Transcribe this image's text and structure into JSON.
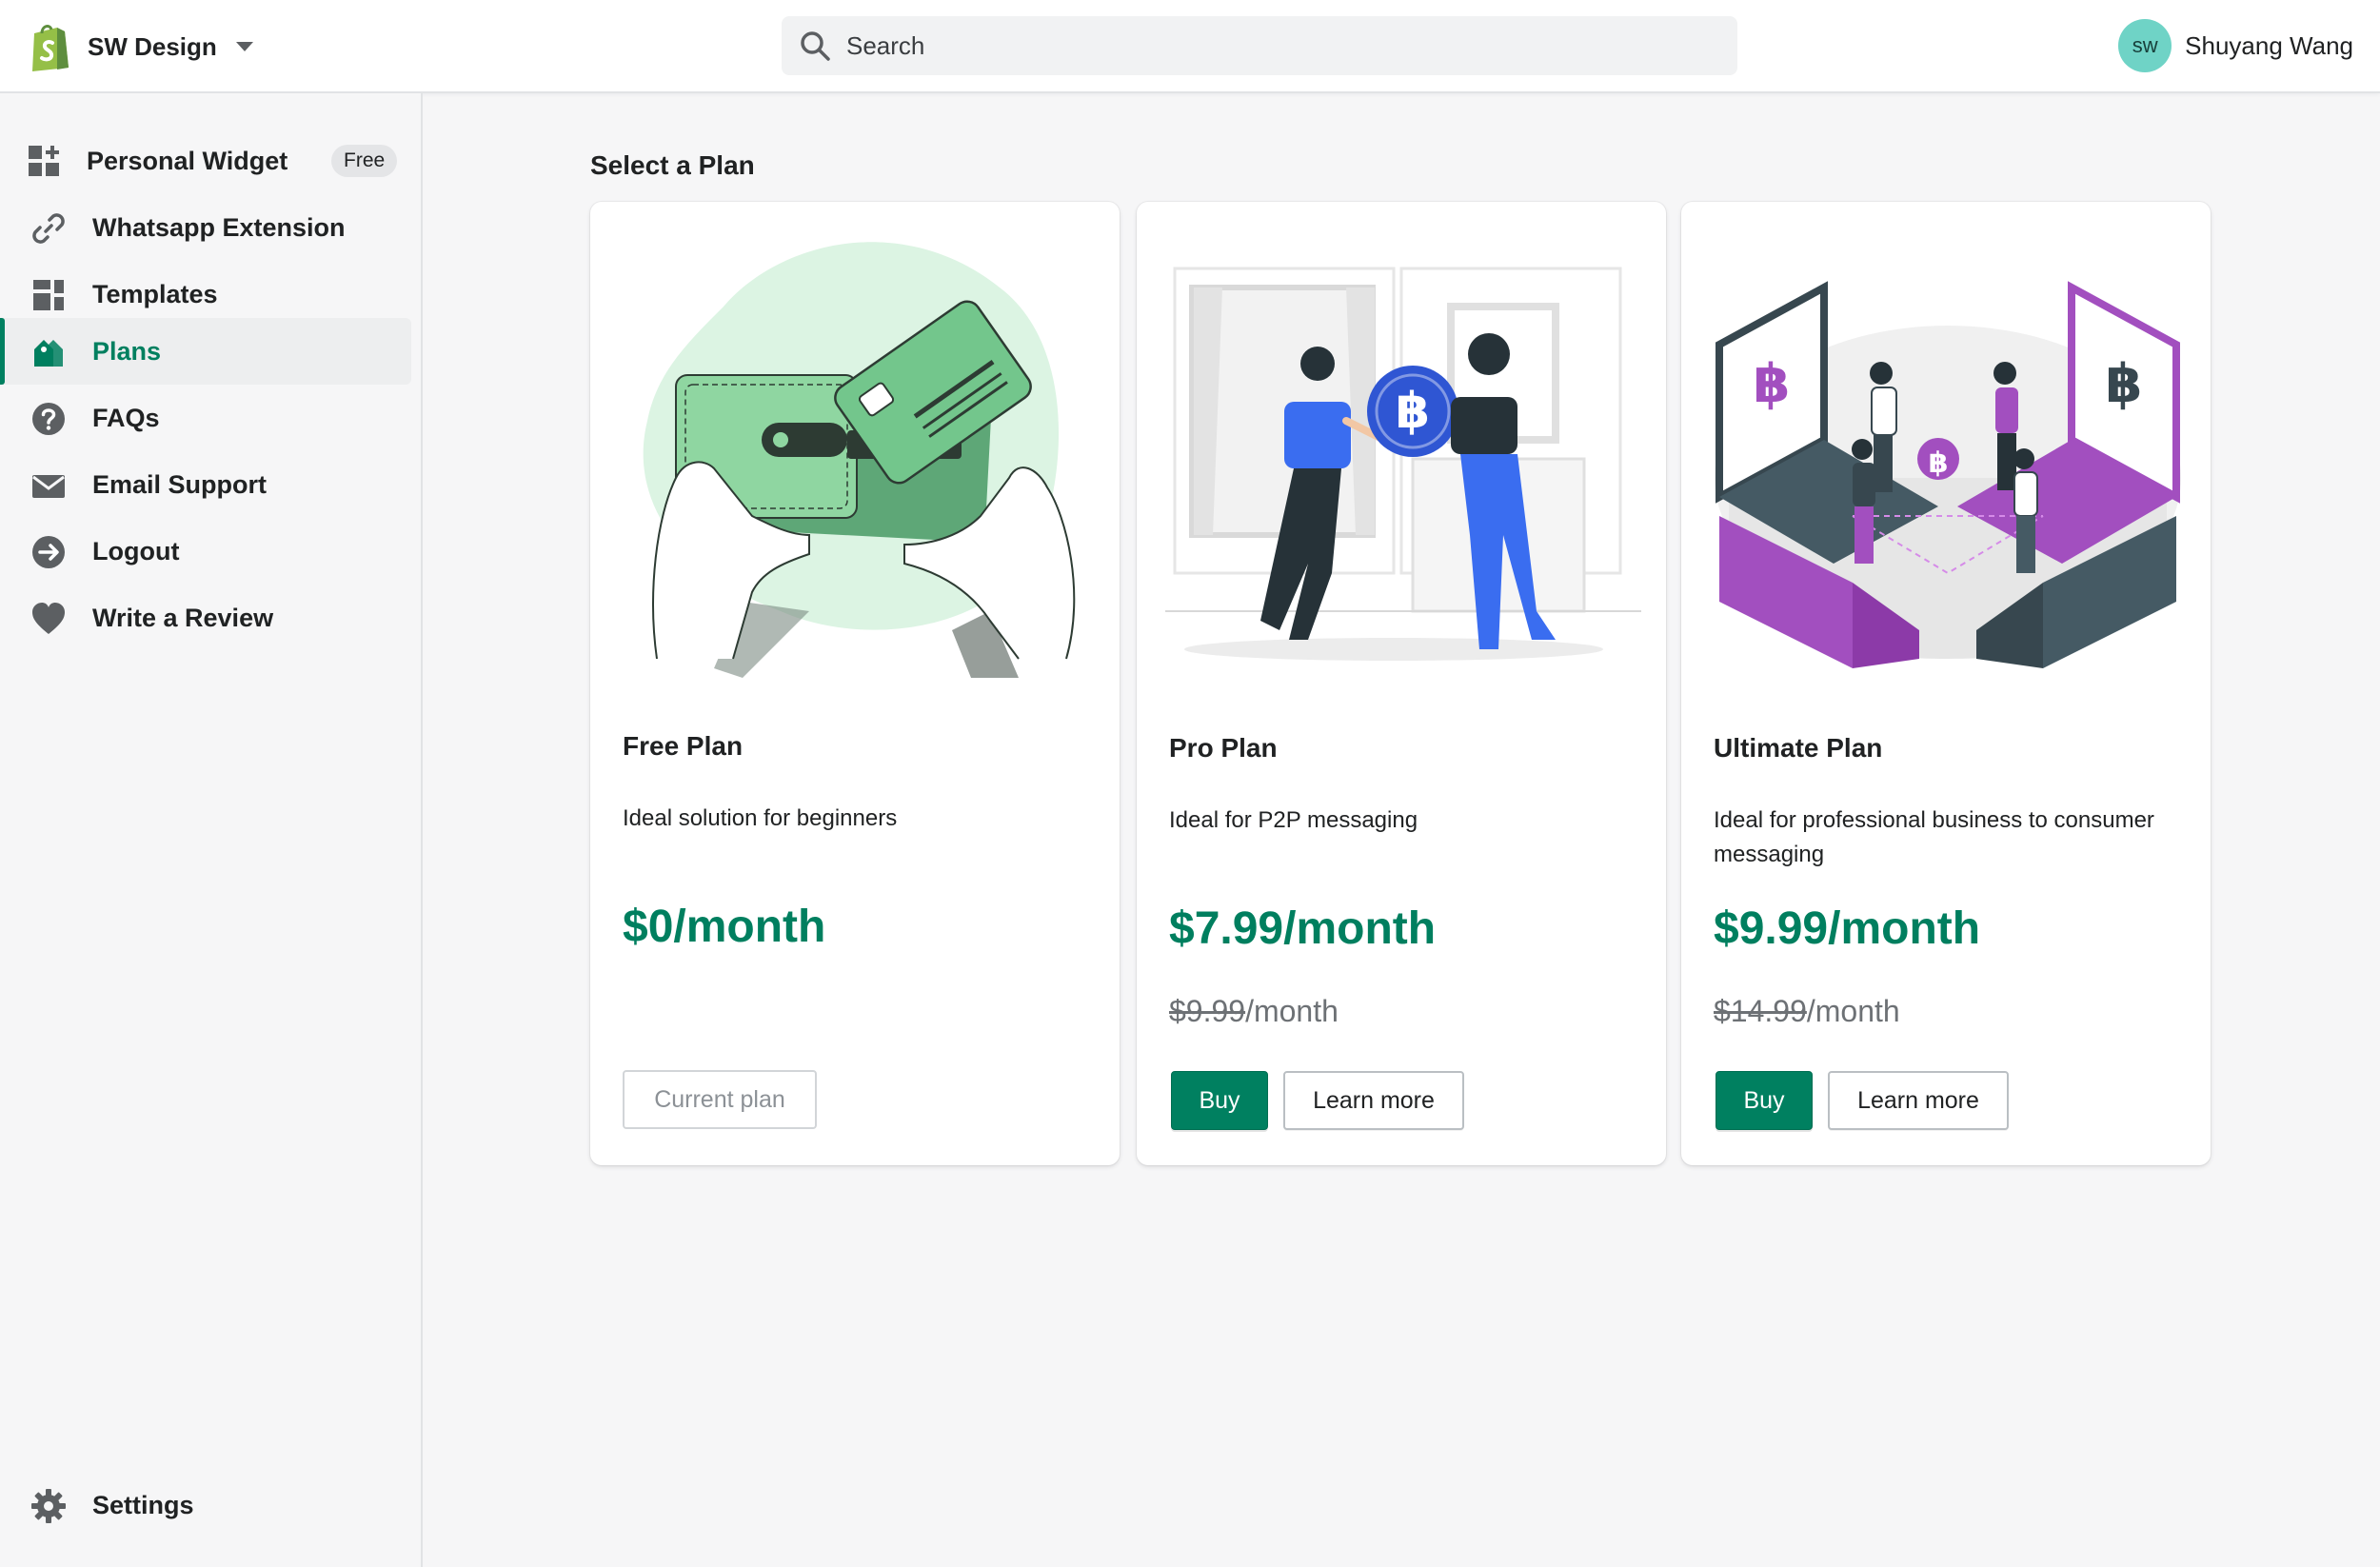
{
  "store": {
    "name": "SW Design"
  },
  "search": {
    "placeholder": "Search"
  },
  "user": {
    "initials": "sw",
    "name": "Shuyang Wang"
  },
  "sidebar": {
    "items": [
      {
        "label": "Personal Widget",
        "icon": "widget-icon",
        "badge": "Free"
      },
      {
        "label": "Whatsapp Extension",
        "icon": "link-icon"
      },
      {
        "label": "Templates",
        "icon": "templates-icon"
      },
      {
        "label": "Plans",
        "icon": "plans-tag-icon",
        "active": true
      },
      {
        "label": "FAQs",
        "icon": "question-icon"
      },
      {
        "label": "Email Support",
        "icon": "email-icon"
      },
      {
        "label": "Logout",
        "icon": "logout-icon"
      },
      {
        "label": "Write a Review",
        "icon": "heart-icon"
      }
    ],
    "settings": {
      "label": "Settings",
      "icon": "gear-icon"
    }
  },
  "main": {
    "title": "Select a Plan",
    "plans": [
      {
        "name": "Free Plan",
        "description": "Ideal solution for beginners",
        "price": "$0/month",
        "button": "Current plan"
      },
      {
        "name": "Pro Plan",
        "description": "Ideal for P2P messaging",
        "price": "$7.99/month",
        "old_price": "$9.99",
        "old_price_suffix": "/month",
        "buy_label": "Buy",
        "more_label": "Learn more"
      },
      {
        "name": "Ultimate Plan",
        "description": "Ideal for professional business to consumer messaging",
        "price": "$9.99/month",
        "old_price": "$14.99",
        "old_price_suffix": "/month",
        "buy_label": "Buy",
        "more_label": "Learn more"
      }
    ]
  },
  "colors": {
    "accent": "#008060",
    "accent_text": "#007f5f",
    "illustration_green": "#7ccf96",
    "illustration_purple": "#a24fbf",
    "illustration_blue": "#2f56d3"
  }
}
